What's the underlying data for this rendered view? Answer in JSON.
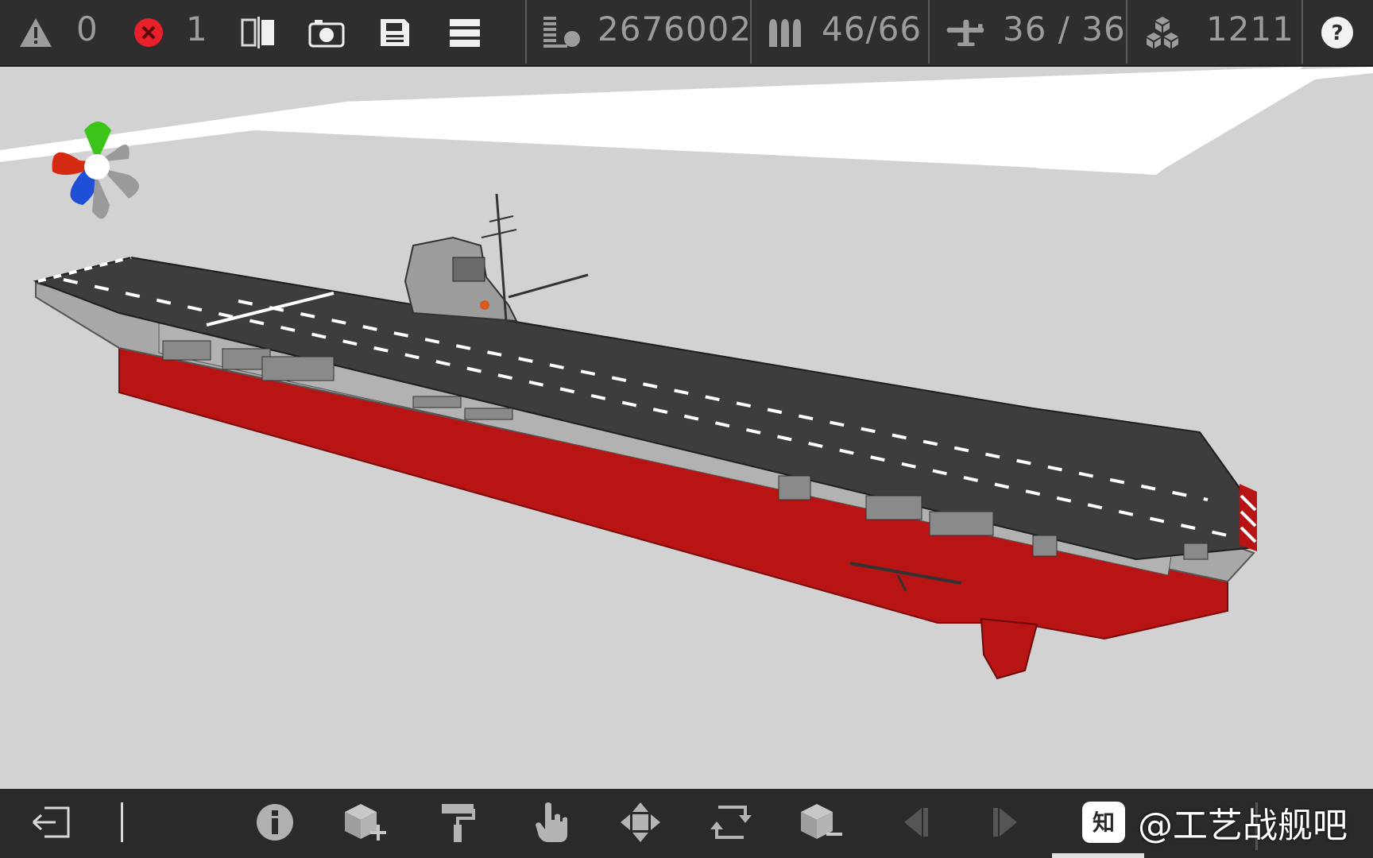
{
  "topbar": {
    "warnings": {
      "icon": "warning-icon",
      "count": "0"
    },
    "errors": {
      "icon": "error-icon",
      "count": "1"
    },
    "mirror": {
      "icon": "mirror-icon"
    },
    "camera": {
      "icon": "camera-icon"
    },
    "save": {
      "icon": "save-icon"
    },
    "menu": {
      "icon": "menu-icon"
    },
    "displacement": {
      "icon": "weight-icon",
      "value": "2676002"
    },
    "ammo": {
      "icon": "ammo-icon",
      "value": "46/66"
    },
    "aircraft": {
      "icon": "airplane-icon",
      "value": "36 / 36"
    },
    "parts": {
      "icon": "blocks-icon",
      "value": "1211"
    },
    "help": {
      "icon": "help-icon",
      "label": "?"
    }
  },
  "toolbar": {
    "exit": {
      "icon": "exit-icon"
    },
    "info": {
      "icon": "info-icon"
    },
    "add_part": {
      "icon": "add-part-icon"
    },
    "paint": {
      "icon": "paint-roller-icon"
    },
    "select": {
      "icon": "hand-pointer-icon"
    },
    "move": {
      "icon": "move-arrows-icon"
    },
    "rotate": {
      "icon": "rotate-icon"
    },
    "remove_part": {
      "icon": "remove-part-icon"
    },
    "prev": {
      "icon": "prev-icon"
    },
    "next": {
      "icon": "next-icon"
    }
  },
  "watermark": {
    "icon": "zhihu-logo",
    "text": "@工艺战舰吧"
  },
  "colors": {
    "bar": "#2e2e2e",
    "hull_red": "#b81414",
    "hull_gray": "#a8a8a8",
    "deck": "#3d3d3d",
    "gizmo_x": "#d42a12",
    "gizmo_y": "#3cc41a",
    "gizmo_z": "#1f4fd6"
  }
}
